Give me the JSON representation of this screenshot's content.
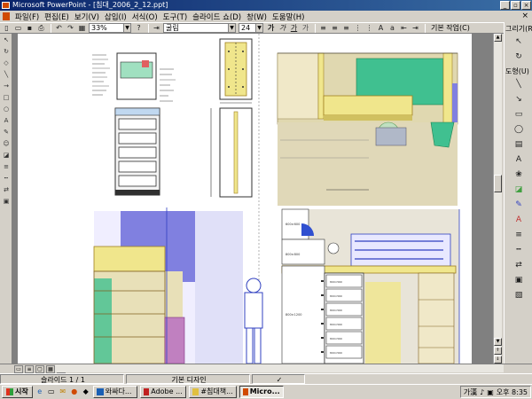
{
  "window": {
    "title": "Microsoft PowerPoint - [침대_2006_2_12.ppt]",
    "buttons": {
      "minimize": "_",
      "restore": "▫",
      "close": "×"
    }
  },
  "menu": {
    "items": [
      "파일(F)",
      "편집(E)",
      "보기(V)",
      "삽입(I)",
      "서식(O)",
      "도구(T)",
      "슬라이드 쇼(D)",
      "창(W)",
      "도움말(H)"
    ],
    "close_doc": "×"
  },
  "toolbar": {
    "zoom": "33%",
    "font": "굴림",
    "font_size": "24",
    "bold": "가",
    "italic": "가",
    "underline": "가",
    "shadow": "가",
    "task_button": "기본 작업(C)"
  },
  "drawing_toolbar": {
    "label_top": "그리기(R)",
    "autoshape_label": "도형(U)"
  },
  "slide_dims": {
    "drawer_labels": [
      "800×560",
      "800×560",
      "800×560",
      "800×560",
      "800×560",
      "800×560"
    ],
    "height_label": "800×1200",
    "top_label": "800×800",
    "small_label": "600×600"
  },
  "statusbar": {
    "slide_info": "슬라이드 1 / 1",
    "design": "기본 디자인",
    "lang": ""
  },
  "taskbar": {
    "start": "시작",
    "tasks": [
      {
        "label": "와싸다...",
        "active": false
      },
      {
        "label": "Adobe ...",
        "active": false
      },
      {
        "label": "#침대책...",
        "active": false
      },
      {
        "label": "Micro...",
        "active": true
      }
    ],
    "ime": "가漢",
    "clock": "오후 8:35"
  },
  "colors": {
    "titlebar": "#0a246a",
    "bed_yellow": "#f0e68c",
    "bed_green": "#40c080",
    "wall_purple": "#8080e0",
    "floor_beige": "#e0d8b0"
  }
}
